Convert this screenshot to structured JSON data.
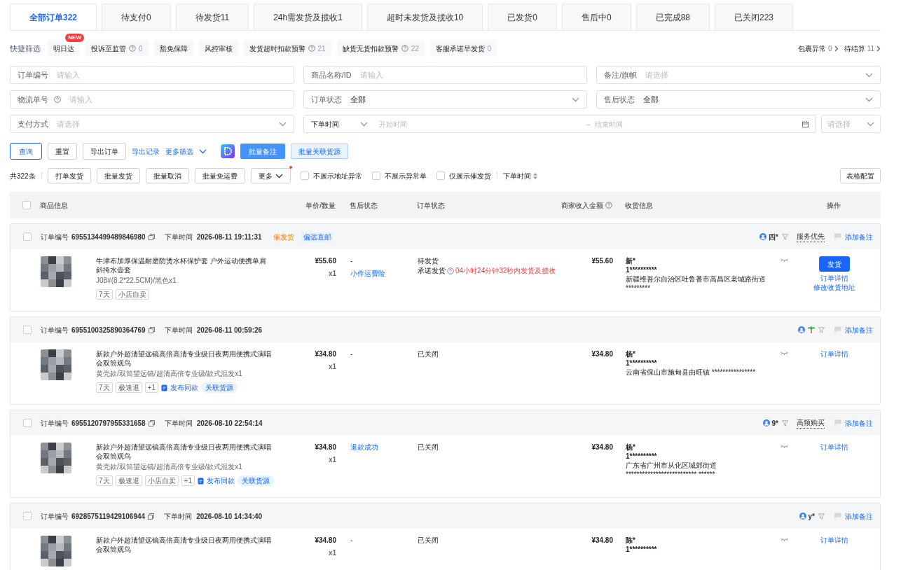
{
  "tabs": [
    {
      "label": "全部订单322",
      "selected": true
    },
    {
      "label": "待支付0",
      "selected": false
    },
    {
      "label": "待发货11",
      "selected": false
    },
    {
      "label": "24h需发货及揽收1",
      "selected": false
    },
    {
      "label": "超时未发货及揽收10",
      "selected": false
    },
    {
      "label": "已发货0",
      "selected": false
    },
    {
      "label": "售后中0",
      "selected": false
    },
    {
      "label": "已完成88",
      "selected": false
    },
    {
      "label": "已关闭223",
      "selected": false
    }
  ],
  "quick_filter": {
    "label": "快捷筛选",
    "chips": [
      {
        "label": "明日达",
        "badge": "NEW"
      },
      {
        "label": "投诉至监管",
        "help": true,
        "count": "0"
      },
      {
        "label": "豁免保障"
      },
      {
        "label": "风控审核"
      },
      {
        "label": "发货超时扣款预警",
        "help": true,
        "count": "21"
      },
      {
        "label": "缺货无货扣款预警",
        "help": true,
        "count": "22"
      },
      {
        "label": "客服承诺早发货",
        "count": "0"
      }
    ],
    "links": [
      {
        "label": "包裹异常",
        "count": "0"
      },
      {
        "label": "待结算",
        "count": "11"
      }
    ]
  },
  "filters": [
    {
      "label": "订单编号",
      "kind": "input",
      "placeholder": "请输入"
    },
    {
      "label": "商品名称/ID",
      "kind": "input",
      "placeholder": "请输入"
    },
    {
      "label": "备注/旗帜",
      "kind": "select",
      "placeholder": "请选择"
    },
    {
      "label": "物流单号",
      "kind": "input",
      "help": true,
      "placeholder": "请输入"
    },
    {
      "label": "订单状态",
      "kind": "select",
      "value": "全部"
    },
    {
      "label": "售后状态",
      "kind": "select",
      "value": "全部"
    },
    {
      "label": "支付方式",
      "kind": "select",
      "placeholder": "请选择"
    }
  ],
  "date_range": {
    "label": "下单时间",
    "start_placeholder": "开始时间",
    "separator": "–",
    "end_placeholder": "结束时间"
  },
  "extra_select": {
    "placeholder": "请选择"
  },
  "actions": [
    {
      "label": "查询",
      "kind": "outline"
    },
    {
      "label": "重置",
      "kind": "default"
    },
    {
      "label": "导出订单",
      "kind": "default"
    },
    {
      "label": "导出记录",
      "kind": "link"
    },
    {
      "label": "更多筛选",
      "kind": "dropdown-link"
    },
    {
      "kind": "logo"
    },
    {
      "label": "批量备注",
      "kind": "solid"
    },
    {
      "label": "批量关联货源",
      "kind": "light"
    }
  ],
  "toolbar": {
    "total": "共322条",
    "buttons": [
      "打单发货",
      "批量发货",
      "批量取消",
      "批量免运费"
    ],
    "more": {
      "label": "更多",
      "dot": true
    },
    "checkboxes": [
      {
        "label": "不展示地址异常",
        "checked": false
      },
      {
        "label": "不展示异常单",
        "checked": false
      },
      {
        "label": "仅展示催发货",
        "checked": false
      }
    ],
    "sort": "下单时间",
    "config": "表格配置"
  },
  "select_all": {
    "checked": false
  },
  "columns": [
    {
      "label": "商品信息"
    },
    {
      "label": "单价/数量"
    },
    {
      "label": "售后状态"
    },
    {
      "label": "订单状态"
    },
    {
      "label": "商家收入金额",
      "help": true
    },
    {
      "label": "收货信息"
    },
    {
      "label": "操作"
    }
  ],
  "orders": [
    {
      "checked": false,
      "order_no_label": "订单编号",
      "order_no": "6955134499489846980",
      "time_label": "下单时间",
      "time": "2026-08-11 19:11:31",
      "flags": [
        {
          "label": "催发货",
          "kind": "warn"
        },
        {
          "label": "偏远直邮",
          "kind": "info"
        }
      ],
      "buyer": "四*",
      "plant_icon": false,
      "buyer_tag": "服务优先",
      "note": "添加备注",
      "product": {
        "title": "牛津布加厚保温耐磨防烫水杯保护套 户外运动便携单肩斜挎水壶套",
        "spec": "J08#(8.2*22.5CM)/黑色x1",
        "tags": [
          {
            "label": "7天",
            "kind": "plain"
          },
          {
            "label": "小店自卖",
            "kind": "plain"
          }
        ]
      },
      "price": "¥55.60",
      "qty": "x1",
      "aftersale": {
        "text": "-",
        "kind": "plain"
      },
      "aftersale_extra": "小件运费险",
      "status": "待发货",
      "promise": {
        "label": "承诺发货",
        "text": "04小时24分钟32秒内发货及揽收"
      },
      "income": "¥55.60",
      "receiver": {
        "name": "新*",
        "phone": "1**********",
        "address": "新疆维吾尔自治区吐鲁番市高昌区老城路街道 *********"
      },
      "ops": [
        {
          "label": "发货",
          "kind": "primary"
        },
        {
          "label": "订单详情",
          "kind": "link"
        },
        {
          "label": "修改收货地址",
          "kind": "link"
        }
      ]
    },
    {
      "checked": false,
      "order_no_label": "订单编号",
      "order_no": "6955100325890364769",
      "time_label": "下单时间",
      "time": "2026-08-11 00:59:26",
      "plant_icon": true,
      "note": "添加备注",
      "product": {
        "title": "新款户外超清望远镜高倍高清专业级日夜两用便携式演唱会双筒观鸟",
        "spec": "黄壳款/双筒望远镜/超清高倍专业级/款式混发x1",
        "tags": [
          {
            "label": "7天",
            "kind": "plain"
          },
          {
            "label": "极速退",
            "kind": "plain"
          },
          {
            "label": "+1",
            "kind": "plain"
          },
          {
            "label": "发布同款",
            "kind": "publish"
          },
          {
            "label": "关联货源",
            "kind": "source"
          }
        ]
      },
      "price": "¥34.80",
      "qty": "x1",
      "aftersale": {
        "text": "-",
        "kind": "plain"
      },
      "status": "已关闭",
      "income": "¥34.80",
      "receiver": {
        "name": "杨*",
        "phone": "1**********",
        "address": "云南省保山市施甸县由旺镇 ****************"
      },
      "ops": [
        {
          "label": "订单详情",
          "kind": "link"
        }
      ]
    },
    {
      "checked": false,
      "order_no_label": "订单编号",
      "order_no": "6955120797955331658",
      "time_label": "下单时间",
      "time": "2026-08-10 22:54:14",
      "buyer": "9*",
      "plant_icon": false,
      "buyer_tag": "高频购买",
      "note": "添加备注",
      "product": {
        "title": "新款户外超清望远镜高倍高清专业级日夜两用便携式演唱会双筒观鸟",
        "spec": "黄壳款/双筒望远镜/超清高倍专业级/款式混发x1",
        "tags": [
          {
            "label": "7天",
            "kind": "plain"
          },
          {
            "label": "极速退",
            "kind": "plain"
          },
          {
            "label": "小店自卖",
            "kind": "plain"
          },
          {
            "label": "+1",
            "kind": "plain"
          },
          {
            "label": "发布同款",
            "kind": "publish"
          },
          {
            "label": "关联货源",
            "kind": "source"
          }
        ]
      },
      "price": "¥34.80",
      "qty": "x1",
      "aftersale": {
        "text": "退款成功",
        "kind": "link"
      },
      "status": "已关闭",
      "income": "¥34.80",
      "receiver": {
        "name": "杨*",
        "phone": "1**********",
        "address": "广东省广州市从化区城郊街道 ************************** ******"
      },
      "ops": [
        {
          "label": "订单详情",
          "kind": "link"
        }
      ]
    },
    {
      "checked": false,
      "order_no_label": "订单编号",
      "order_no": "6928575119429106944",
      "time_label": "下单时间",
      "time": "2026-08-10 14:34:40",
      "buyer": "y*",
      "plant_icon": false,
      "note": "添加备注",
      "product": {
        "title": "新款户外超清望远镜高倍高清专业级日夜两用便携式演唱会双筒观鸟"
      },
      "price": "¥34.80",
      "qty": "x1",
      "aftersale": {
        "text": "-",
        "kind": "plain"
      },
      "status": "已关闭",
      "income": "¥34.80",
      "receiver": {
        "name": "陈*",
        "phone": "1**********"
      },
      "ops": [
        {
          "label": "订单详情",
          "kind": "link"
        }
      ]
    }
  ]
}
